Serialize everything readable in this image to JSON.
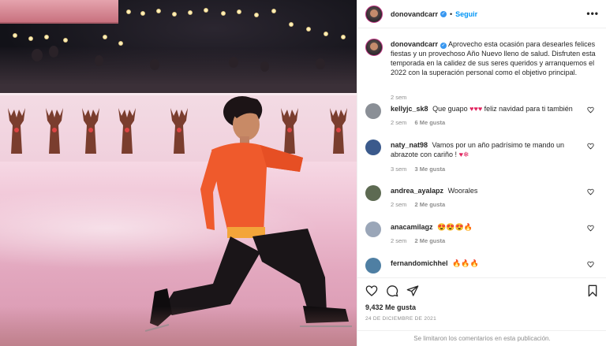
{
  "post": {
    "username": "donovandcarr",
    "follow_label": "Seguir",
    "separator": "•",
    "more_label": "•••",
    "caption": "Aprovecho esta ocasión para desearles felices fiestas y un provechoso Año Nuevo lleno de salud. Disfruten esta temporada en la calidez de sus seres queridos y arranquemos el 2022 con la superación personal como el objetivo principal.",
    "caption_time": "2 sem",
    "likes": "9,432 Me gusta",
    "date": "24 DE DICIEMBRE DE 2021",
    "comments_disabled": "Se limitaron los comentarios en esta publicación."
  },
  "comments": [
    {
      "user": "kellyjc_sk8",
      "text": "Que guapo",
      "emoji_label": "♥♥♥",
      "text_after": "feliz navidad para ti también",
      "time": "2 sem",
      "likes": "6 Me gusta",
      "avatar_color": "#8a8f96"
    },
    {
      "user": "naty_nat98",
      "text": "Vamos por un año padrísimo te mando un abrazote con cariño !",
      "emoji_label": "♥❄",
      "text_after": "",
      "time": "3 sem",
      "likes": "3 Me gusta",
      "avatar_color": "#3b5a8c"
    },
    {
      "user": "andrea_ayalapz",
      "text": "Woorales",
      "emoji_label": "",
      "text_after": "",
      "time": "2 sem",
      "likes": "2 Me gusta",
      "avatar_color": "#5d6a52"
    },
    {
      "user": "anacamilagz",
      "text": "",
      "emoji_label": "😍😍😍🔥",
      "text_after": "",
      "time": "2 sem",
      "likes": "2 Me gusta",
      "avatar_color": "#9aa6b8"
    },
    {
      "user": "fernandomichhel",
      "text": "",
      "emoji_label": "🔥🔥🔥",
      "text_after": "",
      "time": "",
      "likes": "",
      "avatar_color": "#4f7fa3"
    }
  ],
  "icons": {
    "verified": "verified-badge-icon",
    "like": "heart-icon",
    "comment": "comment-icon",
    "share": "send-icon",
    "save": "bookmark-icon"
  },
  "colors": {
    "accent": "#0095f6",
    "verified": "#3897f0",
    "muted": "#8e8e8e",
    "skater_top": "#ef5a2c"
  }
}
